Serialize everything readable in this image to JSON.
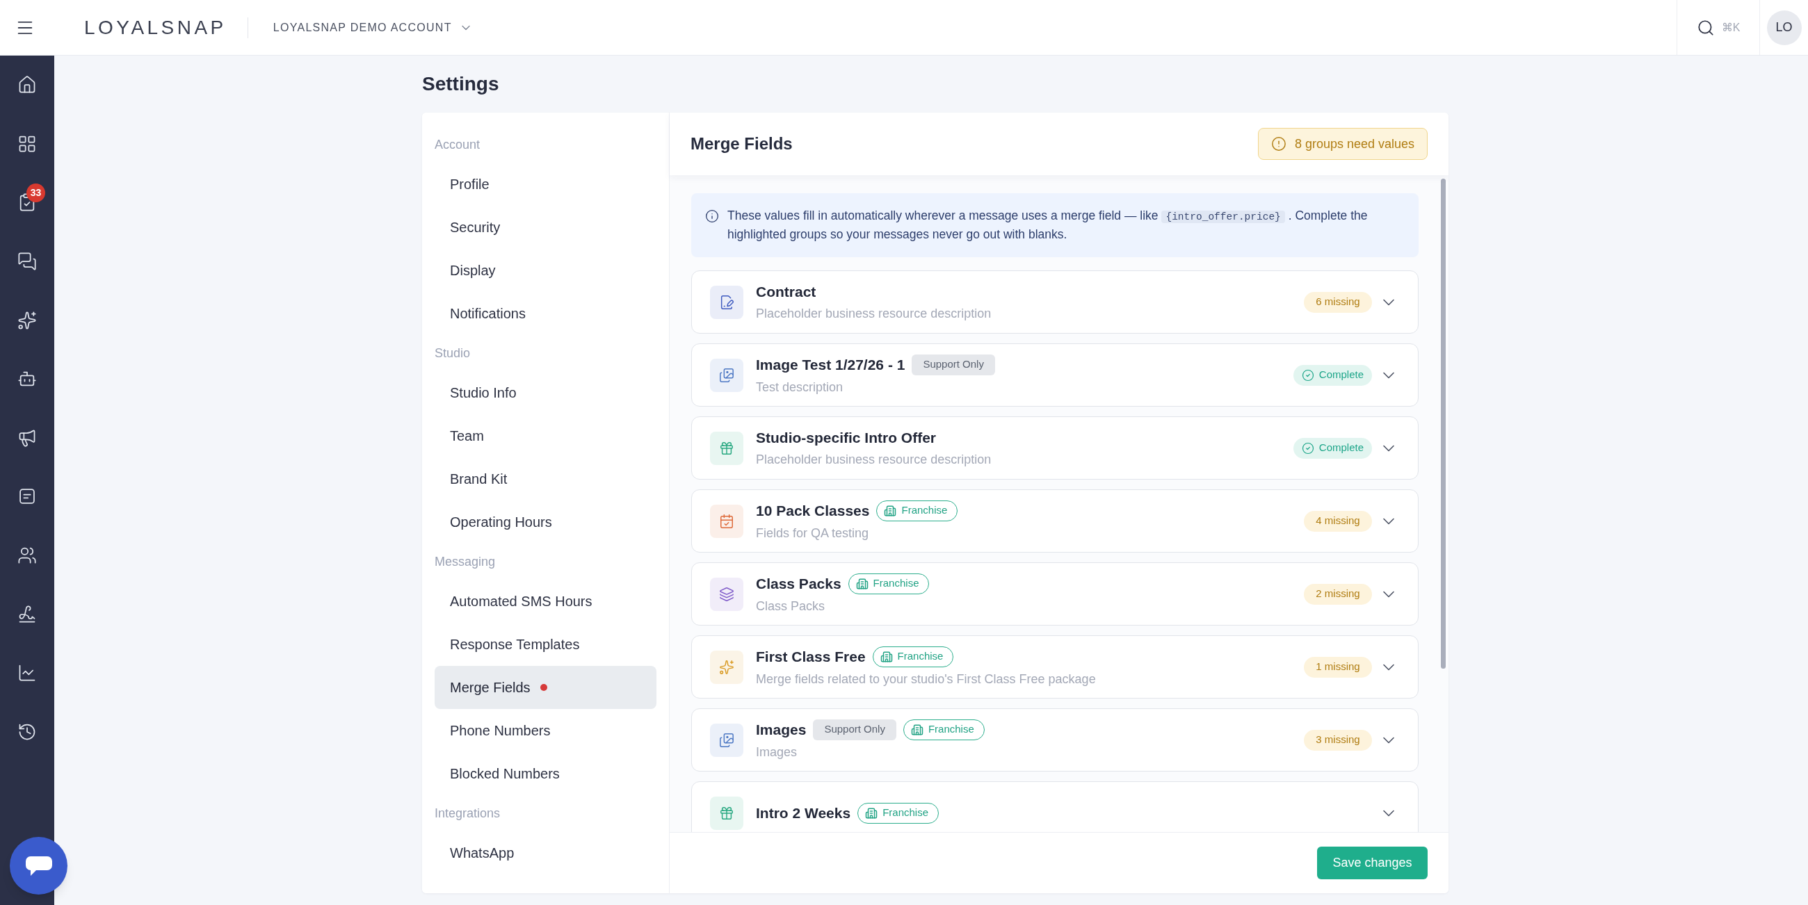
{
  "topbar": {
    "logo": "LOYALSNAP",
    "account": "LOYALSNAP DEMO ACCOUNT",
    "search_shortcut": "⌘K",
    "avatar": "LO"
  },
  "nav_rail": {
    "badge": "33"
  },
  "page_title": "Settings",
  "settings_nav": [
    {
      "heading": "Account",
      "items": [
        {
          "label": "Profile",
          "selected": false,
          "alert": false
        },
        {
          "label": "Security",
          "selected": false,
          "alert": false
        },
        {
          "label": "Display",
          "selected": false,
          "alert": false
        },
        {
          "label": "Notifications",
          "selected": false,
          "alert": false
        }
      ]
    },
    {
      "heading": "Studio",
      "items": [
        {
          "label": "Studio Info",
          "selected": false,
          "alert": false
        },
        {
          "label": "Team",
          "selected": false,
          "alert": false
        },
        {
          "label": "Brand Kit",
          "selected": false,
          "alert": false
        },
        {
          "label": "Operating Hours",
          "selected": false,
          "alert": false
        }
      ]
    },
    {
      "heading": "Messaging",
      "items": [
        {
          "label": "Automated SMS Hours",
          "selected": false,
          "alert": false
        },
        {
          "label": "Response Templates",
          "selected": false,
          "alert": false
        },
        {
          "label": "Merge Fields",
          "selected": true,
          "alert": true
        },
        {
          "label": "Phone Numbers",
          "selected": false,
          "alert": false
        },
        {
          "label": "Blocked Numbers",
          "selected": false,
          "alert": false
        }
      ]
    },
    {
      "heading": "Integrations",
      "items": [
        {
          "label": "WhatsApp",
          "selected": false,
          "alert": false
        }
      ]
    }
  ],
  "panel": {
    "title": "Merge Fields",
    "alert_badge": "8 groups need values",
    "info": {
      "text_before": "These values fill in automatically wherever a message uses a merge field — like",
      "code": "{intro_offer.price}",
      "text_after": ". Complete the highlighted groups so your messages never go out with blanks."
    },
    "groups": [
      {
        "title": "Contract",
        "description": "Placeholder business resource description",
        "color": "#3f5bc0",
        "complete": false,
        "status_label": "6 missing"
      },
      {
        "title": "Image Test 1/27/26 - 1",
        "tags": [
          {
            "kind": "support",
            "label": "Support Only"
          }
        ],
        "description": "Test description",
        "color": "#4d78c4",
        "complete": true,
        "status_label": "Complete"
      },
      {
        "title": "Studio-specific Intro Offer",
        "description": "Placeholder business resource description",
        "color": "#2aa982",
        "complete": true,
        "status_label": "Complete"
      },
      {
        "title": "10 Pack Classes",
        "tags": [
          {
            "kind": "franchise",
            "label": "Franchise"
          }
        ],
        "description": "Fields for QA testing",
        "color": "#de6a3a",
        "complete": false,
        "status_label": "4 missing"
      },
      {
        "title": "Class Packs",
        "tags": [
          {
            "kind": "franchise",
            "label": "Franchise"
          }
        ],
        "description": "Class Packs",
        "color": "#7f5bc9",
        "complete": false,
        "status_label": "2 missing"
      },
      {
        "title": "First Class Free",
        "tags": [
          {
            "kind": "franchise",
            "label": "Franchise"
          }
        ],
        "description": "Merge fields related to your studio's First Class Free package",
        "color": "#d99a22",
        "complete": false,
        "status_label": "1 missing"
      },
      {
        "title": "Images",
        "tags": [
          {
            "kind": "support",
            "label": "Support Only"
          },
          {
            "kind": "franchise",
            "label": "Franchise"
          }
        ],
        "description": "Images",
        "color": "#4d78c4",
        "complete": false,
        "status_label": "3 missing"
      },
      {
        "title": "Intro 2 Weeks",
        "tags": [
          {
            "kind": "franchise",
            "label": "Franchise"
          }
        ],
        "color": "#2aa982"
      }
    ]
  },
  "save_button": "Save changes"
}
